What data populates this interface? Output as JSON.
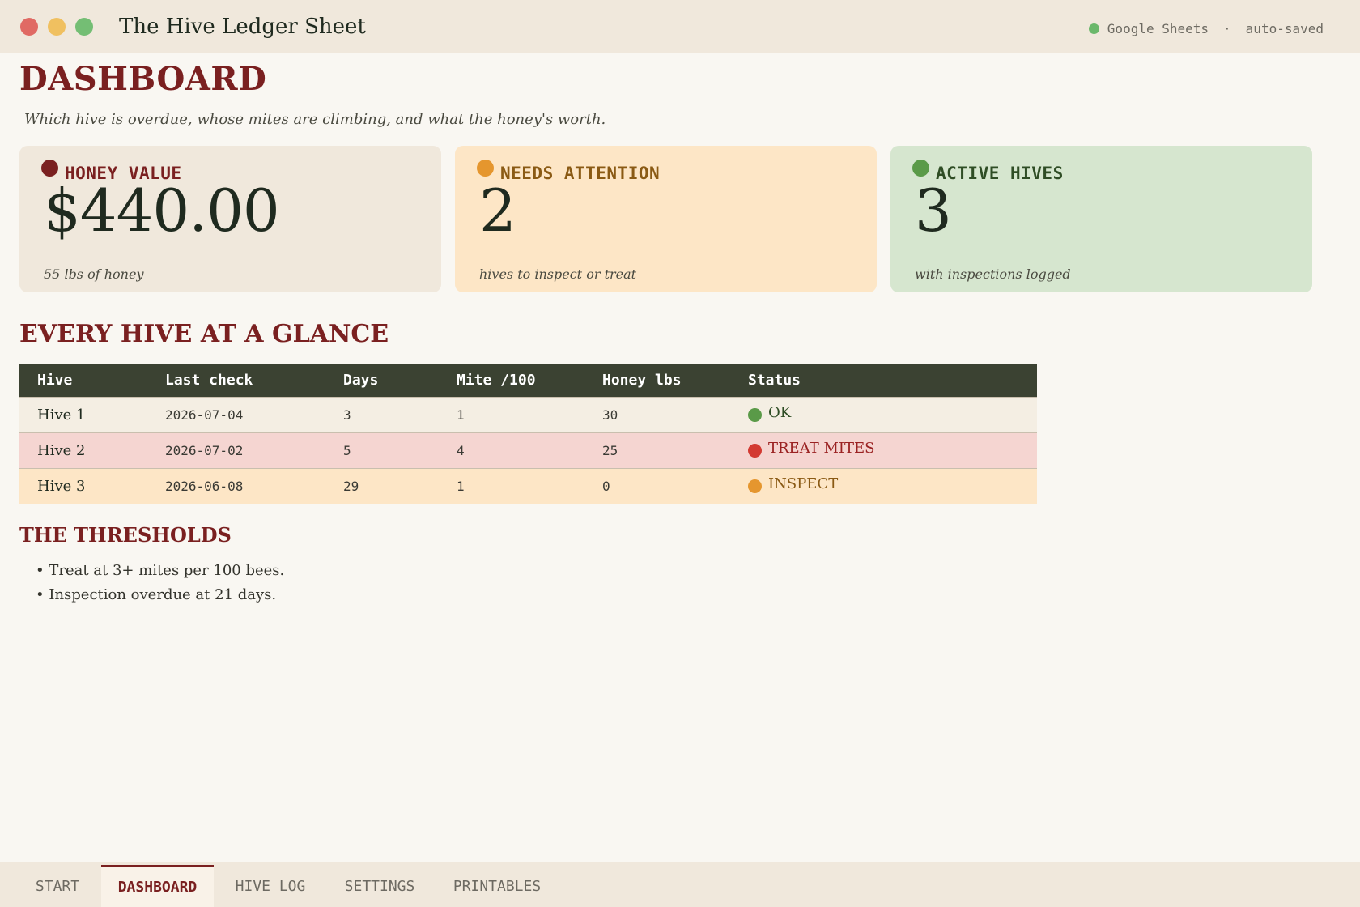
{
  "window": {
    "title": "The Hive Ledger Sheet",
    "traffic_lights": [
      {
        "name": "close",
        "color": "#e06a64"
      },
      {
        "name": "minimize",
        "color": "#f0c060"
      },
      {
        "name": "maximize",
        "color": "#74be74"
      }
    ],
    "app_name": "Google Sheets",
    "separator": "·",
    "save_state": "auto-saved",
    "status_color": "#6bb86b"
  },
  "page": {
    "title": "DASHBOARD",
    "subtitle": "Which hive is overdue, whose mites are climbing, and what the honey's worth."
  },
  "cards": [
    {
      "label": "HONEY VALUE",
      "value": "$440.00",
      "note": "55 lbs of honey",
      "dot_color": "#7a2020",
      "label_color": "#7a2020",
      "bg": "#f0e8dc"
    },
    {
      "label": "NEEDS ATTENTION",
      "value": "2",
      "note": "hives to inspect or treat",
      "dot_color": "#e5962e",
      "label_color": "#8a5a14",
      "bg": "#fde6c6"
    },
    {
      "label": "ACTIVE HIVES",
      "value": "3",
      "note": "with inspections logged",
      "dot_color": "#5a9a48",
      "label_color": "#2f4d25",
      "bg": "#d6e6cf"
    }
  ],
  "glance": {
    "title": "EVERY HIVE AT A GLANCE",
    "columns": [
      "Hive",
      "Last check",
      "Days",
      "Mite /100",
      "Honey lbs",
      "Status"
    ],
    "rows": [
      {
        "hive": "Hive 1",
        "last_check": "2026-07-04",
        "days": "3",
        "mite": "1",
        "honey": "30",
        "status": "OK",
        "status_color": "#5a9a48",
        "status_text_color": "#2f4d25"
      },
      {
        "hive": "Hive 2",
        "last_check": "2026-07-02",
        "days": "5",
        "mite": "4",
        "honey": "25",
        "status": "TREAT MITES",
        "status_color": "#d33a32",
        "status_text_color": "#9a2222"
      },
      {
        "hive": "Hive 3",
        "last_check": "2026-06-08",
        "days": "29",
        "mite": "1",
        "honey": "0",
        "status": "INSPECT",
        "status_color": "#e5962e",
        "status_text_color": "#8a5a14"
      }
    ]
  },
  "thresholds": {
    "title": "THE THRESHOLDS",
    "items": [
      "• Treat at 3+ mites per 100 bees.",
      "• Inspection overdue at 21 days."
    ]
  },
  "tabs": [
    {
      "label": "START",
      "active": false
    },
    {
      "label": "DASHBOARD",
      "active": true
    },
    {
      "label": "HIVE LOG",
      "active": false
    },
    {
      "label": "SETTINGS",
      "active": false
    },
    {
      "label": "PRINTABLES",
      "active": false
    }
  ]
}
